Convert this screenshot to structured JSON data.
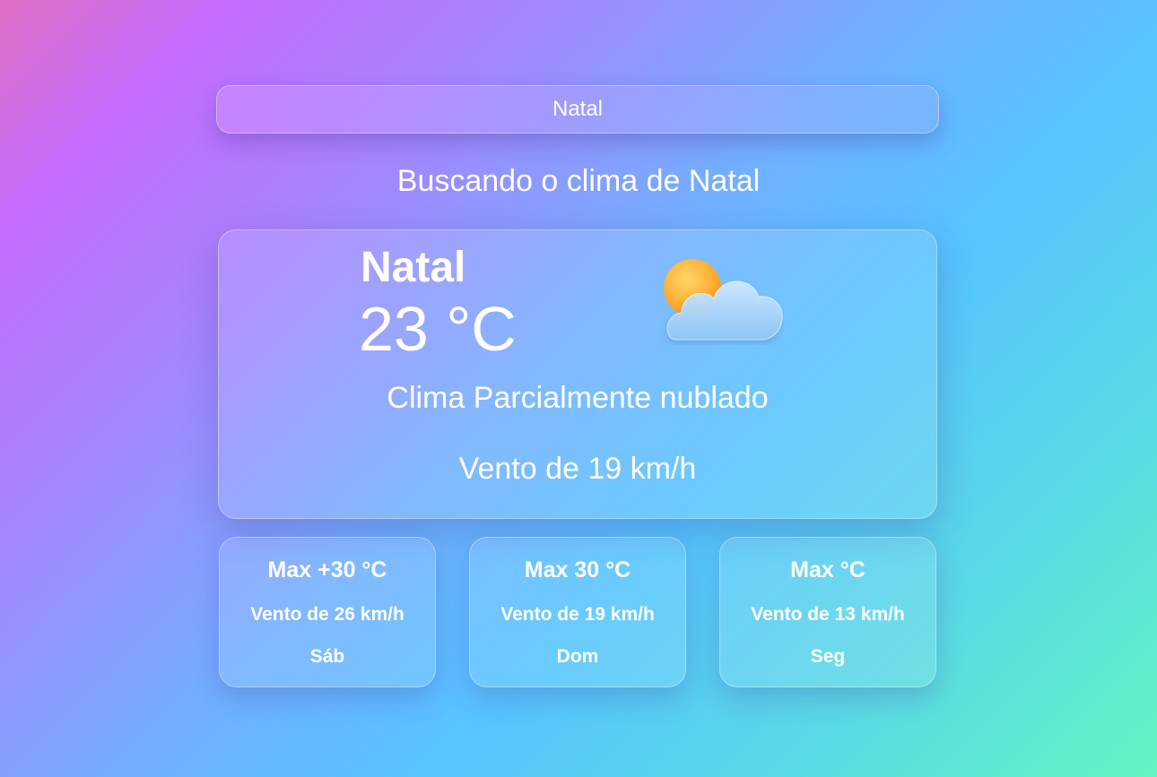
{
  "search": {
    "value": "Natal"
  },
  "status": {
    "text": "Buscando o clima de Natal"
  },
  "current": {
    "city": "Natal",
    "temperature": "23 °C",
    "condition": "Clima Parcialmente nublado",
    "wind": "Vento de 19 km/h",
    "icon": "partly-cloudy-icon"
  },
  "forecast": [
    {
      "max": "Max +30 °C",
      "wind": "Vento de 26 km/h",
      "day": "Sáb"
    },
    {
      "max": "Max 30 °C",
      "wind": "Vento de 19 km/h",
      "day": "Dom"
    },
    {
      "max": "Max °C",
      "wind": "Vento de 13 km/h",
      "day": "Seg"
    }
  ],
  "colors": {
    "text": "#ffffff",
    "gradient_start": "#df6fc4",
    "gradient_mid_purple": "#c46bff",
    "gradient_mid_blue": "#56c4ff",
    "gradient_end": "#62f5c2"
  }
}
